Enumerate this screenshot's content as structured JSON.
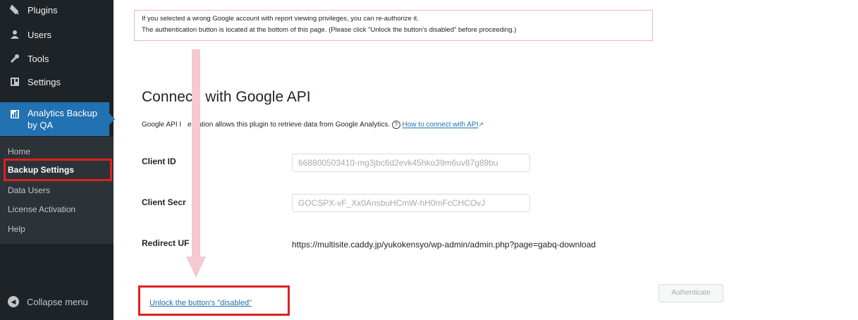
{
  "sidebar": {
    "menu": [
      {
        "label": "Plugins",
        "icon": "plugin-icon"
      },
      {
        "label": "Users",
        "icon": "users-icon"
      },
      {
        "label": "Tools",
        "icon": "wrench-icon"
      },
      {
        "label": "Settings",
        "icon": "settings-icon"
      }
    ],
    "current": {
      "label_line1": "Analytics Backup",
      "label_line2": "by QA",
      "icon": "analytics-icon"
    },
    "submenu": [
      {
        "label": "Home"
      },
      {
        "label": "Backup Settings",
        "active": true
      },
      {
        "label": "Data Users"
      },
      {
        "label": "License Activation"
      },
      {
        "label": "Help"
      }
    ],
    "collapse_label": "Collapse menu"
  },
  "notice": {
    "line1": "If you selected a wrong Google account with report viewing privileges, you can re-authorize it.",
    "line2": "The authentication button is located at the bottom of this page. (Please click \"Unlock the button's disabled\" before proceeding.)"
  },
  "section": {
    "heading_part1": "Connec",
    "heading_part2": " with Google API",
    "desc_part1": "Google API I",
    "desc_part2": "egration allows this plugin to retrieve data from Google Analytics.",
    "help_glyph": "?",
    "link_text": "How to connect with API"
  },
  "fields": {
    "client_id": {
      "label": "Client ID",
      "value": "668800503410-mg3jbc6d2evk45hko39m6uv87g89bu"
    },
    "client_secret": {
      "label": "Client Secr",
      "value": "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"
    },
    "redirect": {
      "label": "Redirect UF",
      "value": "https://multisite.caddy.jp/yukokensyo/wp-admin/admin.php?page=gabq-download"
    }
  },
  "unlock_link": "Unlock the button's \"disabled\"",
  "authenticate_button": "Authenticate",
  "colors": {
    "sidebar_bg": "#1d2327",
    "submenu_bg": "#2c3338",
    "accent": "#2271b1",
    "highlight_red": "#e02020",
    "arrow_pink": "#f4c9cf"
  }
}
